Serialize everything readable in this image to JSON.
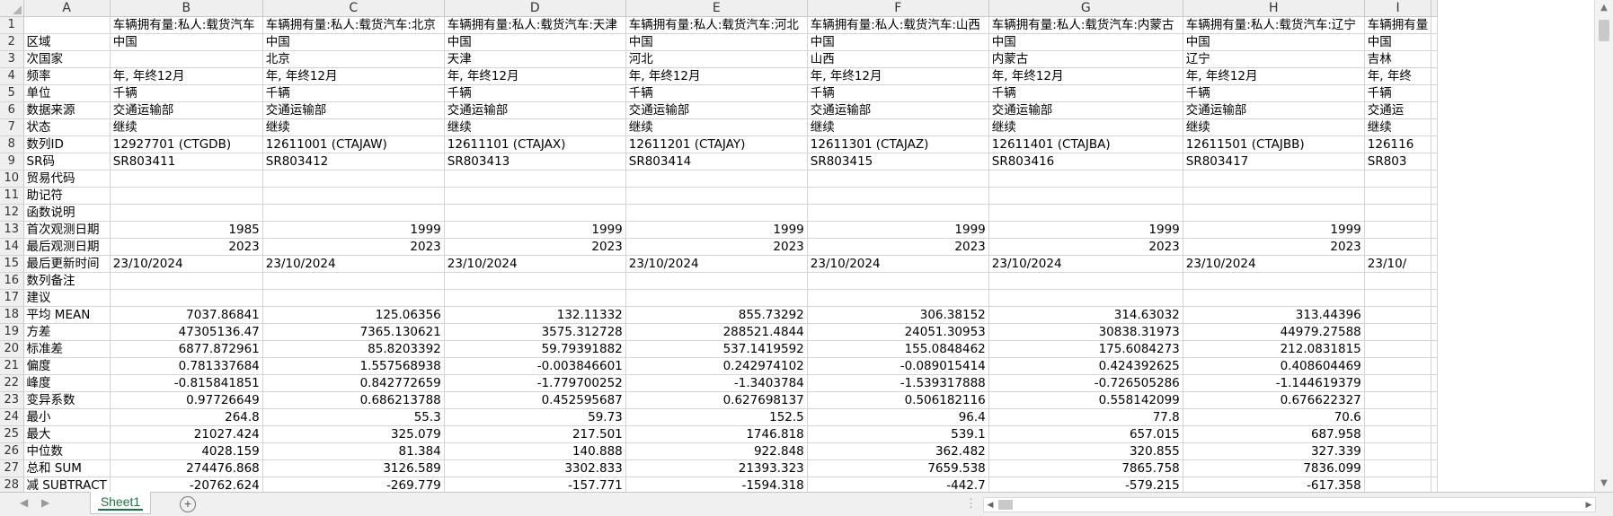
{
  "columns": [
    "A",
    "B",
    "C",
    "D",
    "E",
    "F",
    "G",
    "H",
    "I"
  ],
  "rows": [
    {
      "n": "1",
      "cells": [
        "",
        "车辆拥有量:私人:载货汽车",
        "车辆拥有量:私人:载货汽车:北京",
        "车辆拥有量:私人:载货汽车:天津",
        "车辆拥有量:私人:载货汽车:河北",
        "车辆拥有量:私人:载货汽车:山西",
        "车辆拥有量:私人:载货汽车:内蒙古",
        "车辆拥有量:私人:载货汽车:辽宁",
        "车辆拥有量"
      ]
    },
    {
      "n": "2",
      "cells": [
        "区域",
        "中国",
        "中国",
        "中国",
        "中国",
        "中国",
        "中国",
        "中国",
        "中国"
      ]
    },
    {
      "n": "3",
      "cells": [
        "次国家",
        "",
        "北京",
        "天津",
        "河北",
        "山西",
        "内蒙古",
        "辽宁",
        "吉林"
      ]
    },
    {
      "n": "4",
      "cells": [
        "频率",
        "年, 年终12月",
        "年, 年终12月",
        "年, 年终12月",
        "年, 年终12月",
        "年, 年终12月",
        "年, 年终12月",
        "年, 年终12月",
        "年, 年终"
      ]
    },
    {
      "n": "5",
      "cells": [
        "单位",
        "千辆",
        "千辆",
        "千辆",
        "千辆",
        "千辆",
        "千辆",
        "千辆",
        "千辆"
      ]
    },
    {
      "n": "6",
      "cells": [
        "数据来源",
        "交通运输部",
        "交通运输部",
        "交通运输部",
        "交通运输部",
        "交通运输部",
        "交通运输部",
        "交通运输部",
        "交通运"
      ]
    },
    {
      "n": "7",
      "cells": [
        "状态",
        "继续",
        "继续",
        "继续",
        "继续",
        "继续",
        "继续",
        "继续",
        "继续"
      ]
    },
    {
      "n": "8",
      "cells": [
        "数列ID",
        "12927701 (CTGDB)",
        "12611001 (CTAJAW)",
        "12611101 (CTAJAX)",
        "12611201 (CTAJAY)",
        "12611301 (CTAJAZ)",
        "12611401 (CTAJBA)",
        "12611501 (CTAJBB)",
        "126116"
      ]
    },
    {
      "n": "9",
      "cells": [
        "SR码",
        "SR803411",
        "SR803412",
        "SR803413",
        "SR803414",
        "SR803415",
        "SR803416",
        "SR803417",
        "SR803"
      ]
    },
    {
      "n": "10",
      "cells": [
        "贸易代码",
        "",
        "",
        "",
        "",
        "",
        "",
        "",
        ""
      ]
    },
    {
      "n": "11",
      "cells": [
        "助记符",
        "",
        "",
        "",
        "",
        "",
        "",
        "",
        ""
      ]
    },
    {
      "n": "12",
      "cells": [
        "函数说明",
        "",
        "",
        "",
        "",
        "",
        "",
        "",
        ""
      ]
    },
    {
      "n": "13",
      "num": true,
      "cells": [
        "首次观测日期",
        "1985",
        "1999",
        "1999",
        "1999",
        "1999",
        "1999",
        "1999",
        ""
      ]
    },
    {
      "n": "14",
      "num": true,
      "cells": [
        "最后观测日期",
        "2023",
        "2023",
        "2023",
        "2023",
        "2023",
        "2023",
        "2023",
        ""
      ]
    },
    {
      "n": "15",
      "cells": [
        "最后更新时间",
        "23/10/2024",
        "23/10/2024",
        "23/10/2024",
        "23/10/2024",
        "23/10/2024",
        "23/10/2024",
        "23/10/2024",
        "23/10/"
      ]
    },
    {
      "n": "16",
      "cells": [
        "数列备注",
        "",
        "",
        "",
        "",
        "",
        "",
        "",
        ""
      ]
    },
    {
      "n": "17",
      "cells": [
        "建议",
        "",
        "",
        "",
        "",
        "",
        "",
        "",
        ""
      ]
    },
    {
      "n": "18",
      "num": true,
      "cells": [
        "平均 MEAN",
        "7037.86841",
        "125.06356",
        "132.11332",
        "855.73292",
        "306.38152",
        "314.63032",
        "313.44396",
        ""
      ]
    },
    {
      "n": "19",
      "num": true,
      "cells": [
        "方差",
        "47305136.47",
        "7365.130621",
        "3575.312728",
        "288521.4844",
        "24051.30953",
        "30838.31973",
        "44979.27588",
        ""
      ]
    },
    {
      "n": "20",
      "num": true,
      "cells": [
        "标准差",
        "6877.872961",
        "85.8203392",
        "59.79391882",
        "537.1419592",
        "155.0848462",
        "175.6084273",
        "212.0831815",
        ""
      ]
    },
    {
      "n": "21",
      "num": true,
      "cells": [
        "偏度",
        "0.781337684",
        "1.557568938",
        "-0.003846601",
        "0.242974102",
        "-0.089015414",
        "0.424392625",
        "0.408604469",
        ""
      ]
    },
    {
      "n": "22",
      "num": true,
      "cells": [
        "峰度",
        "-0.815841851",
        "0.842772659",
        "-1.779700252",
        "-1.3403784",
        "-1.539317888",
        "-0.726505286",
        "-1.144619379",
        ""
      ]
    },
    {
      "n": "23",
      "num": true,
      "cells": [
        "变异系数",
        "0.97726649",
        "0.686213788",
        "0.452595687",
        "0.627698137",
        "0.506182116",
        "0.558142099",
        "0.676622327",
        ""
      ]
    },
    {
      "n": "24",
      "num": true,
      "cells": [
        "最小",
        "264.8",
        "55.3",
        "59.73",
        "152.5",
        "96.4",
        "77.8",
        "70.6",
        ""
      ]
    },
    {
      "n": "25",
      "num": true,
      "cells": [
        "最大",
        "21027.424",
        "325.079",
        "217.501",
        "1746.818",
        "539.1",
        "657.015",
        "687.958",
        ""
      ]
    },
    {
      "n": "26",
      "num": true,
      "cells": [
        "中位数",
        "4028.159",
        "81.384",
        "140.888",
        "922.848",
        "362.482",
        "320.855",
        "327.339",
        ""
      ]
    },
    {
      "n": "27",
      "num": true,
      "cells": [
        "总和 SUM",
        "274476.868",
        "3126.589",
        "3302.833",
        "21393.323",
        "7659.538",
        "7865.758",
        "7836.099",
        ""
      ]
    },
    {
      "n": "28",
      "num": true,
      "cells": [
        "减 SUBTRACT",
        "-20762.624",
        "-269.779",
        "-157.771",
        "-1594.318",
        "-442.7",
        "-579.215",
        "-617.358",
        ""
      ]
    }
  ],
  "sheet_tab": "Sheet1",
  "add_sheet_symbol": "+",
  "nav_prev": "◀",
  "nav_next": "▶",
  "dots": "⋮"
}
